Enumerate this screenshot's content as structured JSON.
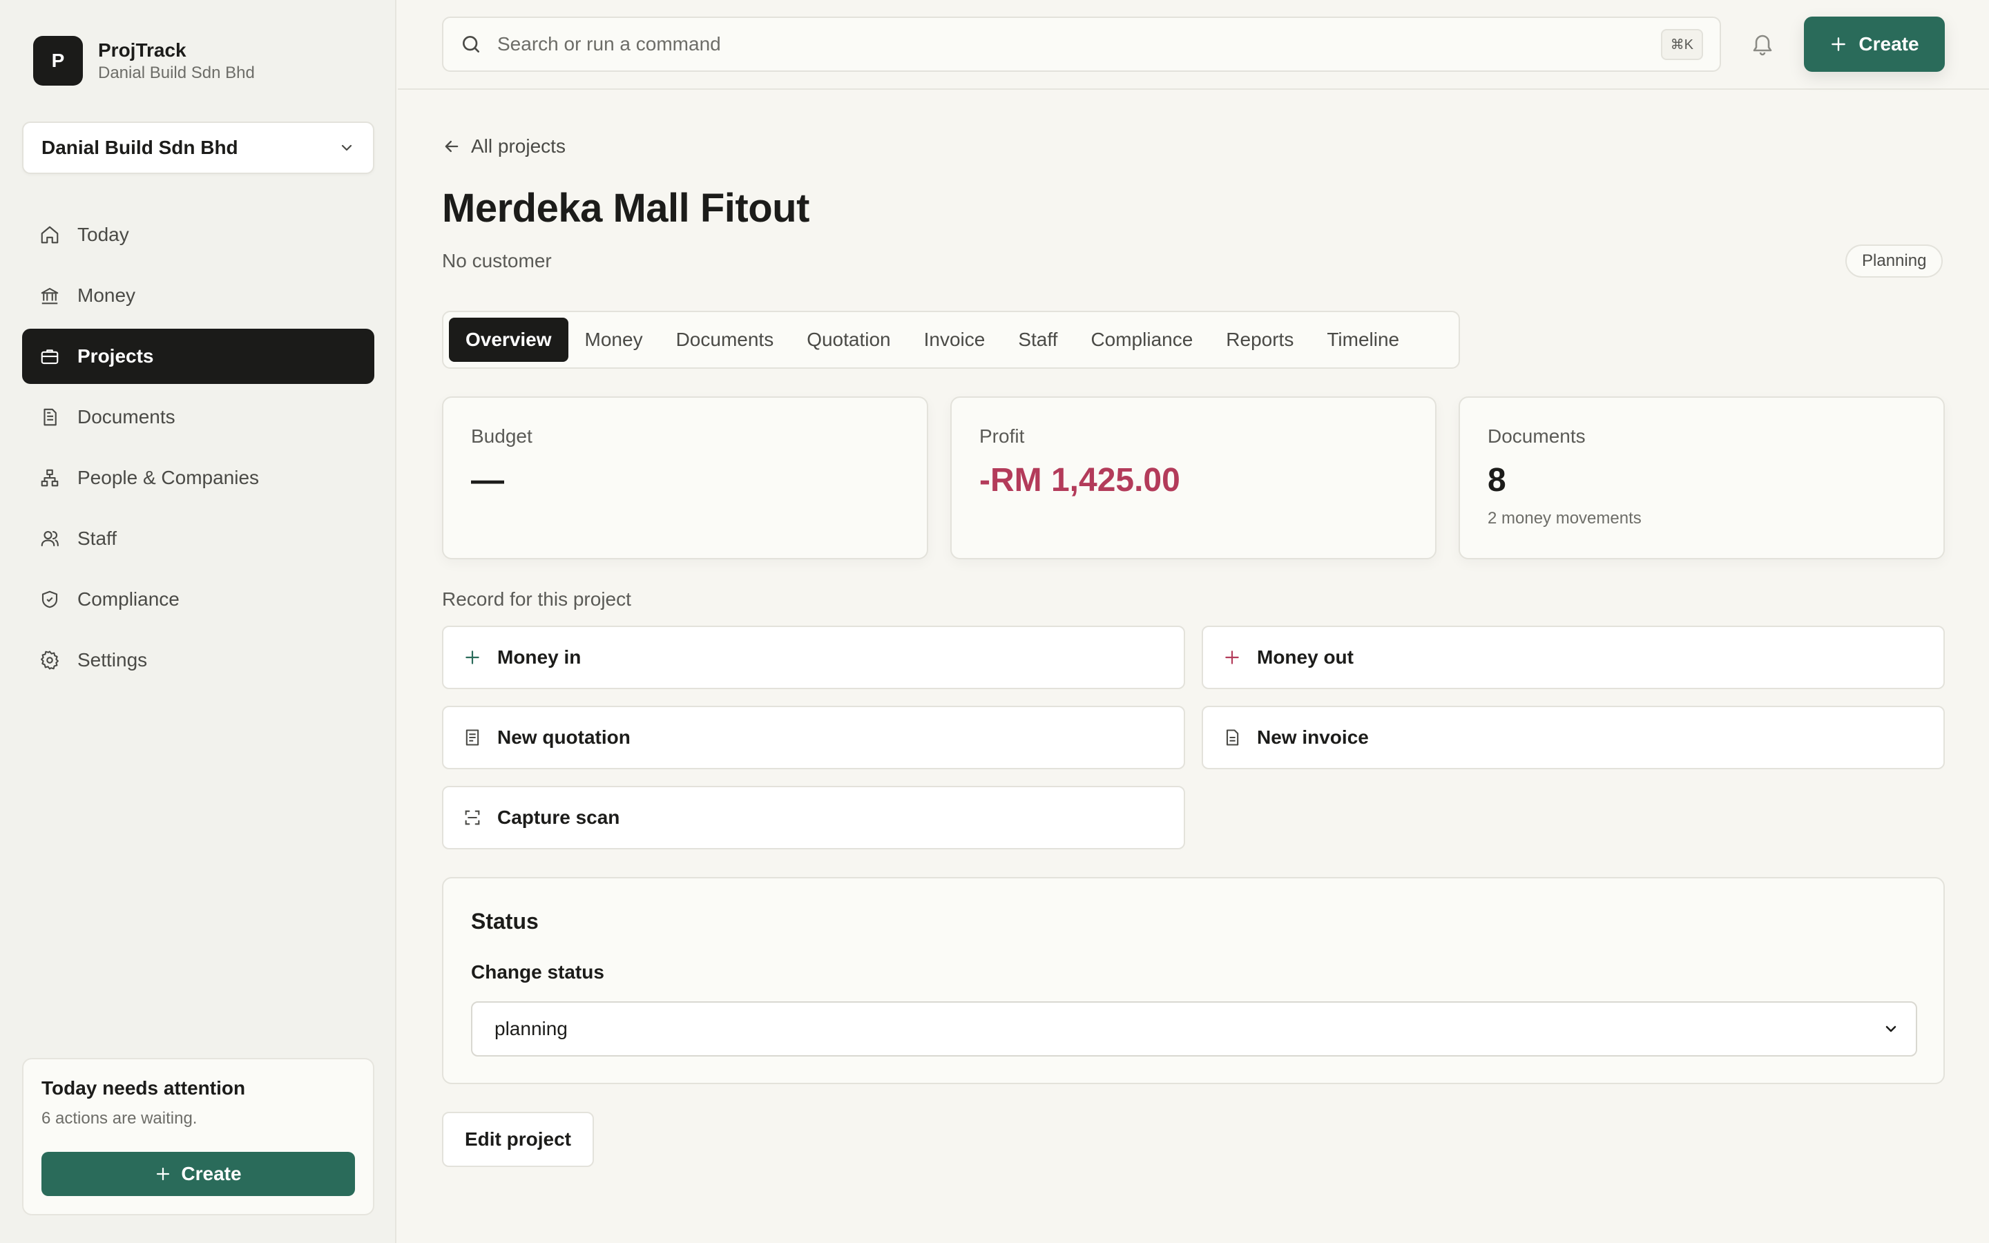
{
  "brand": {
    "logo_letter": "P",
    "name": "ProjTrack",
    "subtitle": "Danial Build Sdn Bhd"
  },
  "org_selector": {
    "value": "Danial Build Sdn Bhd"
  },
  "sidebar": {
    "items": [
      {
        "label": "Today",
        "icon": "home-icon",
        "active": false
      },
      {
        "label": "Money",
        "icon": "bank-icon",
        "active": false
      },
      {
        "label": "Projects",
        "icon": "briefcase-icon",
        "active": true
      },
      {
        "label": "Documents",
        "icon": "document-icon",
        "active": false
      },
      {
        "label": "People & Companies",
        "icon": "org-chart-icon",
        "active": false
      },
      {
        "label": "Staff",
        "icon": "users-icon",
        "active": false
      },
      {
        "label": "Compliance",
        "icon": "shield-icon",
        "active": false
      },
      {
        "label": "Settings",
        "icon": "gear-icon",
        "active": false
      }
    ],
    "attention": {
      "title": "Today needs attention",
      "subtitle": "6 actions are waiting.",
      "button_label": "Create"
    }
  },
  "topbar": {
    "search_placeholder": "Search or run a command",
    "shortcut": "⌘K",
    "create_label": "Create"
  },
  "project": {
    "back_label": "All projects",
    "title": "Merdeka Mall Fitout",
    "customer": "No customer",
    "status_badge": "Planning"
  },
  "tabs": [
    "Overview",
    "Money",
    "Documents",
    "Quotation",
    "Invoice",
    "Staff",
    "Compliance",
    "Reports",
    "Timeline"
  ],
  "active_tab": "Overview",
  "stats": {
    "budget": {
      "label": "Budget",
      "value": "—"
    },
    "profit": {
      "label": "Profit",
      "value": "-RM 1,425.00"
    },
    "documents": {
      "label": "Documents",
      "value": "8",
      "sub": "2 money movements"
    }
  },
  "record": {
    "label": "Record for this project",
    "actions": {
      "money_in": "Money in",
      "money_out": "Money out",
      "new_quotation": "New quotation",
      "new_invoice": "New invoice",
      "capture_scan": "Capture scan"
    }
  },
  "status_section": {
    "title": "Status",
    "field_label": "Change status",
    "selected": "planning"
  },
  "edit_label": "Edit project",
  "colors": {
    "accent": "#2a6b5a",
    "negative": "#b33b5a",
    "dark": "#1b1b19",
    "background": "#f7f6f1"
  }
}
